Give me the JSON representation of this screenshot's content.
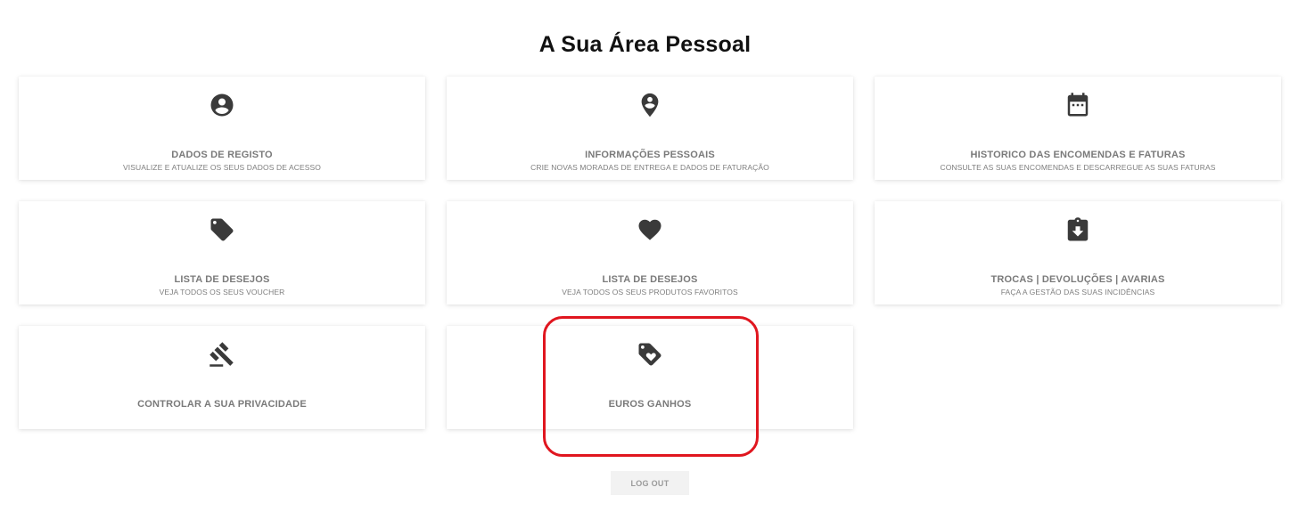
{
  "page": {
    "title": "A Sua Área Pessoal"
  },
  "cards": [
    {
      "icon": "account-circle-icon",
      "title": "DADOS DE REGISTO",
      "subtitle": "VISUALIZE E ATUALIZE OS SEUS DADOS DE ACESSO"
    },
    {
      "icon": "map-pin-person-icon",
      "title": "INFORMAÇÕES PESSOAIS",
      "subtitle": "CRIE NOVAS MORADAS DE ENTREGA E DADOS DE FATURAÇÃO"
    },
    {
      "icon": "calendar-icon",
      "title": "HISTORICO DAS ENCOMENDAS E FATURAS",
      "subtitle": "CONSULTE AS SUAS ENCOMENDAS E DESCARREGUE AS SUAS FATURAS"
    },
    {
      "icon": "tag-icon",
      "title": "LISTA DE DESEJOS",
      "subtitle": "VEJA TODOS OS SEUS VOUCHER"
    },
    {
      "icon": "heart-icon",
      "title": "LISTA DE DESEJOS",
      "subtitle": "VEJA TODOS OS SEUS PRODUTOS FAVORITOS"
    },
    {
      "icon": "clipboard-download-icon",
      "title": "TROCAS | DEVOLUÇÕES | AVARIAS",
      "subtitle": "FAÇA A GESTÃO DAS SUAS INCIDÊNCIAS"
    },
    {
      "icon": "gavel-icon",
      "title": "CONTROLAR A SUA PRIVACIDADE"
    },
    {
      "icon": "tag-heart-icon",
      "title": "EUROS GANHOS"
    }
  ],
  "logout": {
    "label": "LOG OUT"
  },
  "colors": {
    "highlight": "#e0161f",
    "icon": "#3a3a3a",
    "text": "#7a7a7a"
  }
}
